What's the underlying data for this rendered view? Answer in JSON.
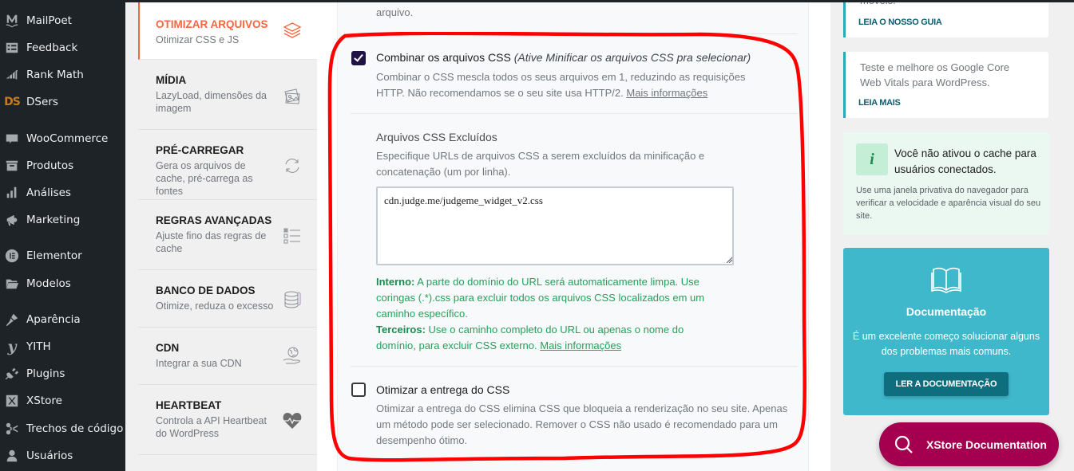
{
  "wp_menu": [
    {
      "label": "MailPoet",
      "icon": "mailpoet-icon"
    },
    {
      "label": "Feedback",
      "icon": "feedback-icon"
    },
    {
      "label": "Rank Math",
      "icon": "rank-math-icon"
    },
    {
      "label": "DSers",
      "icon": "dsers-icon",
      "glyph": "DS"
    },
    {
      "label": "WooCommerce",
      "icon": "woocommerce-icon"
    },
    {
      "label": "Produtos",
      "icon": "products-icon"
    },
    {
      "label": "Análises",
      "icon": "analytics-icon"
    },
    {
      "label": "Marketing",
      "icon": "megaphone-icon"
    },
    {
      "label": "Elementor",
      "icon": "elementor-icon"
    },
    {
      "label": "Modelos",
      "icon": "folder-icon"
    },
    {
      "label": "Aparência",
      "icon": "brush-icon"
    },
    {
      "label": "YITH",
      "icon": "yith-icon"
    },
    {
      "label": "Plugins",
      "icon": "plug-icon"
    },
    {
      "label": "XStore",
      "icon": "xstore-icon"
    },
    {
      "label": "Trechos de código",
      "icon": "scissors-icon"
    },
    {
      "label": "Usuários",
      "icon": "user-icon"
    }
  ],
  "settings_nav": [
    {
      "title": "OTIMIZAR ARQUIVOS",
      "subtitle": "Otimizar CSS e JS",
      "icon": "layers-icon",
      "active": true
    },
    {
      "title": "MÍDIA",
      "subtitle": "LazyLoad, dimensões da imagem",
      "icon": "images-icon"
    },
    {
      "title": "PRÉ-CARREGAR",
      "subtitle": "Gera os arquivos de cache, pré-carrega as fontes",
      "icon": "refresh-icon"
    },
    {
      "title": "REGRAS AVANÇADAS",
      "subtitle": "Ajuste fino das regras de cache",
      "icon": "checklist-icon"
    },
    {
      "title": "BANCO DE DADOS",
      "subtitle": "Otimize, reduza o excesso",
      "icon": "database-icon"
    },
    {
      "title": "CDN",
      "subtitle": "Integrar a sua CDN",
      "icon": "globe-hand-icon"
    },
    {
      "title": "HEARTBEAT",
      "subtitle": "Controla a API Heartbeat do WordPress",
      "icon": "heartbeat-icon"
    }
  ],
  "main": {
    "previous_text_tail": "arquivo.",
    "combine_css": {
      "checked": true,
      "label": "Combinar os arquivos CSS",
      "label_note": "(Ative Minificar os arquivos CSS pra selecionar)",
      "description": "Combinar o CSS mescla todos os seus arquivos em 1, reduzindo as requisições HTTP. Não recomendamos se o seu site usa HTTP/2.",
      "more_link": "Mais informações"
    },
    "excluded_css": {
      "title": "Arquivos CSS Excluídos",
      "description": "Especifique URLs de arquivos CSS a serem excluídos da minificação e concatenação (um por linha).",
      "value": "cdn.judge.me/judgeme_widget_v2.css",
      "help_internal_label": "Interno:",
      "help_internal": "A parte do domínio do URL será automaticamente limpa. Use coringas (.*).css para excluir todos os arquivos CSS localizados em um caminho específico.",
      "help_third_label": "Terceiros:",
      "help_third": "Use o caminho completo do URL ou apenas o nome do domínio, para excluir CSS externo.",
      "more_link": "Mais informações"
    },
    "optimize_delivery": {
      "checked": false,
      "label": "Otimizar a entrega do CSS",
      "description": "Otimizar a entrega do CSS elimina CSS que bloqueia a renderização no seu site. Apenas um método pode ser selecionado. Remover o CSS não usado é recomendado para um desempenho ótimo."
    }
  },
  "right_column": {
    "card1": {
      "text_tail": "móveis.",
      "link": "LEIA O NOSSO GUIA"
    },
    "card2": {
      "text": "Teste e melhore os Google Core Web Vitals para WordPress.",
      "link": "LEIA MAIS"
    },
    "notice": {
      "icon": "info-icon",
      "glyph": "i",
      "title": "Você não ativou o cache para usuários conectados.",
      "text": "Use uma janela privativa do navegador para verificar a velocidade e aparência visual do seu site."
    },
    "documentation": {
      "title": "Documentação",
      "text": "É um excelente começo solucionar alguns dos problemas mais comuns.",
      "button": "LER A DOCUMENTAÇÃO"
    }
  },
  "floating_button": {
    "label": "XStore Documentation"
  },
  "colors": {
    "accent_orange": "#f56640",
    "checkbox_checked": "#1f1343",
    "help_green": "#23a15a",
    "teal": "#40b8cc",
    "teal_dark": "#0e6e7e",
    "xstore": "#a5004f",
    "annotation_red": "#ff0000"
  }
}
